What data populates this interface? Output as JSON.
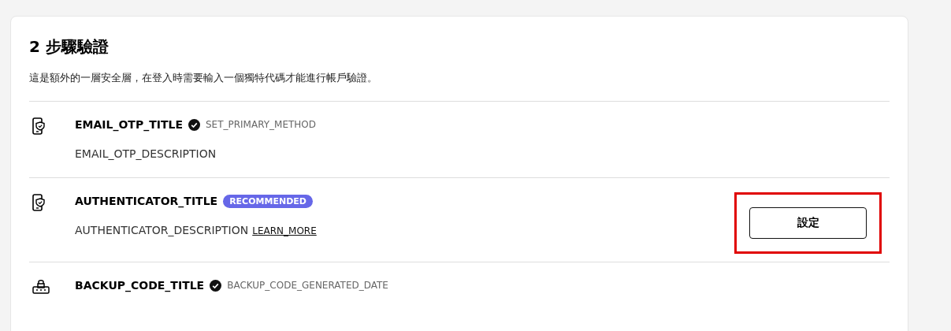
{
  "title": "2 步驟驗證",
  "description": "這是額外的一層安全層，在登入時需要輸入一個獨特代碼才能進行帳戶驗證。",
  "methods": [
    {
      "kind": "phone",
      "title": "EMAIL_OTP_TITLE",
      "verified": true,
      "status": "SET_PRIMARY_METHOD",
      "description": "EMAIL_OTP_DESCRIPTION"
    },
    {
      "kind": "phone",
      "title": "AUTHENTICATOR_TITLE",
      "verified": false,
      "badge": "RECOMMENDED",
      "description": "AUTHENTICATOR_DESCRIPTION",
      "link": "LEARN_MORE",
      "button": "設定",
      "highlighted": true
    },
    {
      "kind": "lock",
      "title": "BACKUP_CODE_TITLE",
      "verified": true,
      "status": "BACKUP_CODE_GENERATED_DATE"
    }
  ]
}
